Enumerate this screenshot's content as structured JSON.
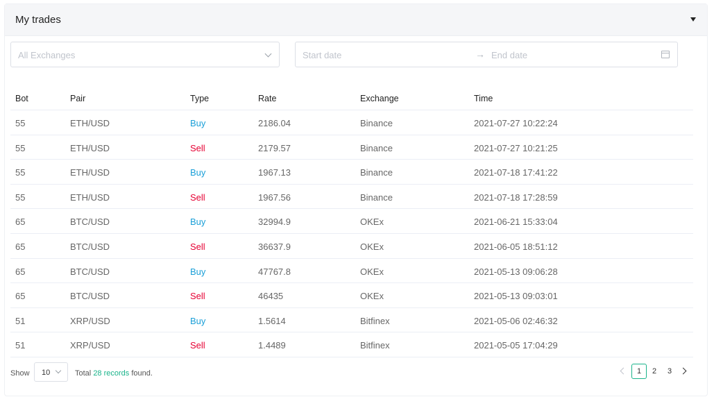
{
  "panel": {
    "title": "My trades"
  },
  "filters": {
    "exchange_placeholder": "All Exchanges",
    "start_date_placeholder": "Start date",
    "end_date_placeholder": "End date",
    "range_separator": "→"
  },
  "table": {
    "headers": [
      "Bot",
      "Pair",
      "Type",
      "Rate",
      "Exchange",
      "Time"
    ],
    "rows": [
      [
        "55",
        "ETH/USD",
        "Buy",
        "2186.04",
        "Binance",
        "2021-07-27 10:22:24"
      ],
      [
        "55",
        "ETH/USD",
        "Sell",
        "2179.57",
        "Binance",
        "2021-07-27 10:21:25"
      ],
      [
        "55",
        "ETH/USD",
        "Buy",
        "1967.13",
        "Binance",
        "2021-07-18 17:41:22"
      ],
      [
        "55",
        "ETH/USD",
        "Sell",
        "1967.56",
        "Binance",
        "2021-07-18 17:28:59"
      ],
      [
        "65",
        "BTC/USD",
        "Buy",
        "32994.9",
        "OKEx",
        "2021-06-21 15:33:04"
      ],
      [
        "65",
        "BTC/USD",
        "Sell",
        "36637.9",
        "OKEx",
        "2021-06-05 18:51:12"
      ],
      [
        "65",
        "BTC/USD",
        "Buy",
        "47767.8",
        "OKEx",
        "2021-05-13 09:06:28"
      ],
      [
        "65",
        "BTC/USD",
        "Sell",
        "46435",
        "OKEx",
        "2021-05-13 09:03:01"
      ],
      [
        "51",
        "XRP/USD",
        "Buy",
        "1.5614",
        "Bitfinex",
        "2021-05-06 02:46:32"
      ],
      [
        "51",
        "XRP/USD",
        "Sell",
        "1.4489",
        "Bitfinex",
        "2021-05-05 17:04:29"
      ]
    ]
  },
  "footer": {
    "show_label": "Show",
    "page_size": "10",
    "total_prefix": "Total",
    "total_count": "28 records",
    "total_suffix": "found."
  },
  "pagination": {
    "pages": [
      "1",
      "2",
      "3"
    ],
    "current": "1"
  },
  "colors": {
    "buy": "#1a9fd8",
    "sell": "#e60033",
    "accent": "#19b38a"
  }
}
